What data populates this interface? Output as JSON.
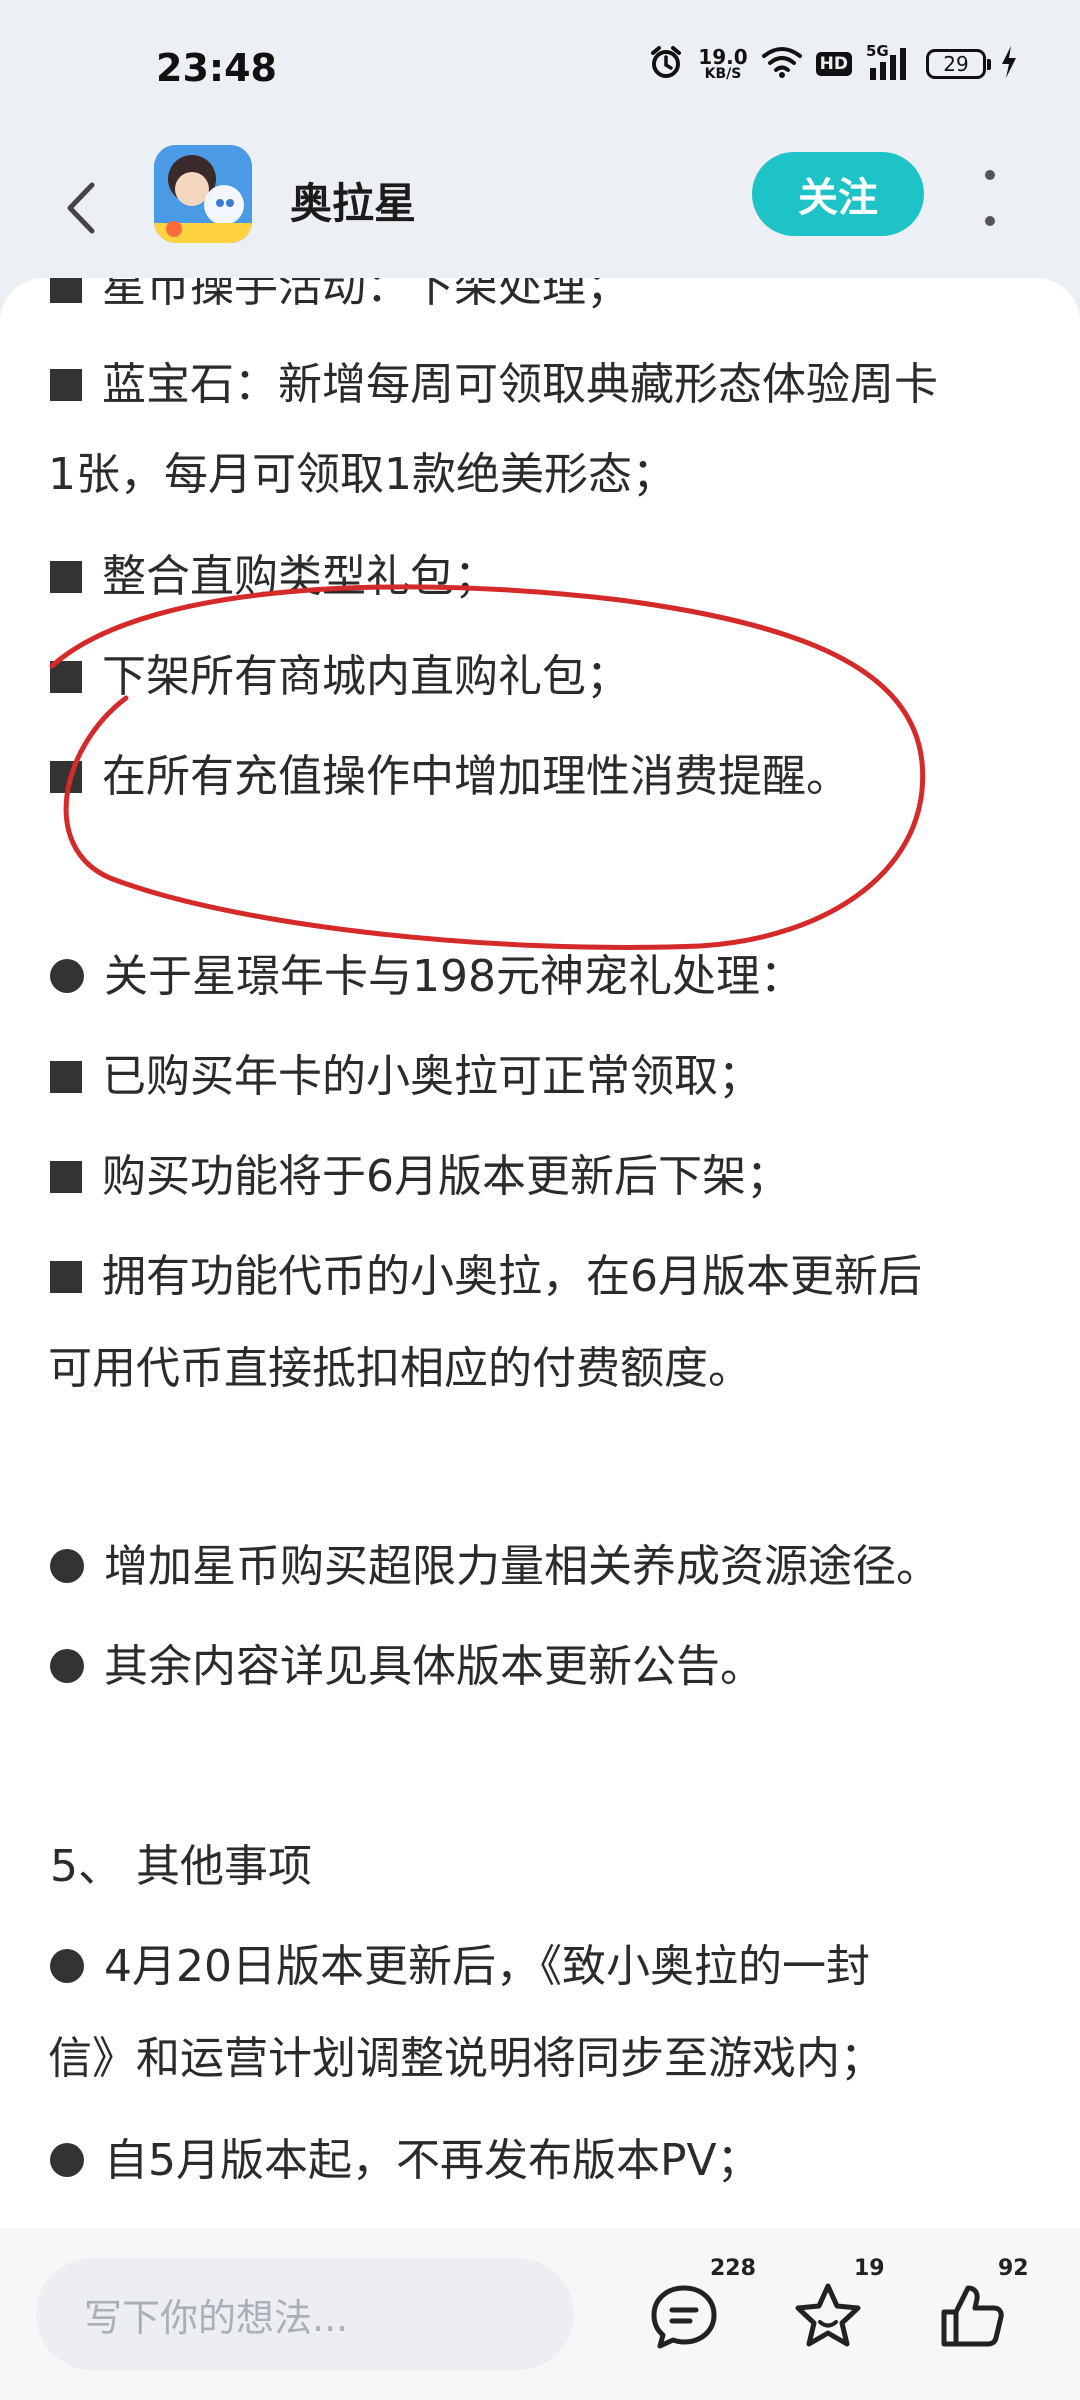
{
  "status_bar": {
    "time": "23:48",
    "net_speed_value": "19.0",
    "net_speed_unit": "KB/S",
    "hd_label": "HD",
    "signal_label": "5G",
    "battery_level": "29",
    "icons": [
      "alarm-icon",
      "wifi-icon",
      "signal-icon",
      "charging-icon"
    ]
  },
  "header": {
    "title": "奥拉星",
    "follow_label": "关注",
    "accent_color": "#1ec3c8"
  },
  "content": {
    "lines": [
      "星币操手活动：下架处理；",
      "蓝宝石：新增每周可领取典藏形态体验周卡",
      "1张，每月可领取1款绝美形态；",
      "整合直购类型礼包；",
      "下架所有商城内直购礼包；",
      "在所有充值操作中增加理性消费提醒。",
      "关于星璟年卡与198元神宠礼处理：",
      "已购买年卡的小奥拉可正常领取；",
      "购买功能将于6月版本更新后下架；",
      "拥有功能代币的小奥拉，在6月版本更新后",
      "可用代币直接抵扣相应的付费额度。",
      "增加星币购买超限力量相关养成资源途径。",
      "其余内容详见具体版本更新公告。",
      "5、 其他事项",
      "4月20日版本更新后，《致小奥拉的一封",
      "信》和运营计划调整说明将同步至游戏内；",
      "自5月版本起，不再发布版本PV；"
    ],
    "annotation_color": "#d42a2a"
  },
  "bottom_bar": {
    "comment_placeholder": "写下你的想法...",
    "comment_count": "228",
    "favorite_count": "19",
    "like_count": "92"
  }
}
